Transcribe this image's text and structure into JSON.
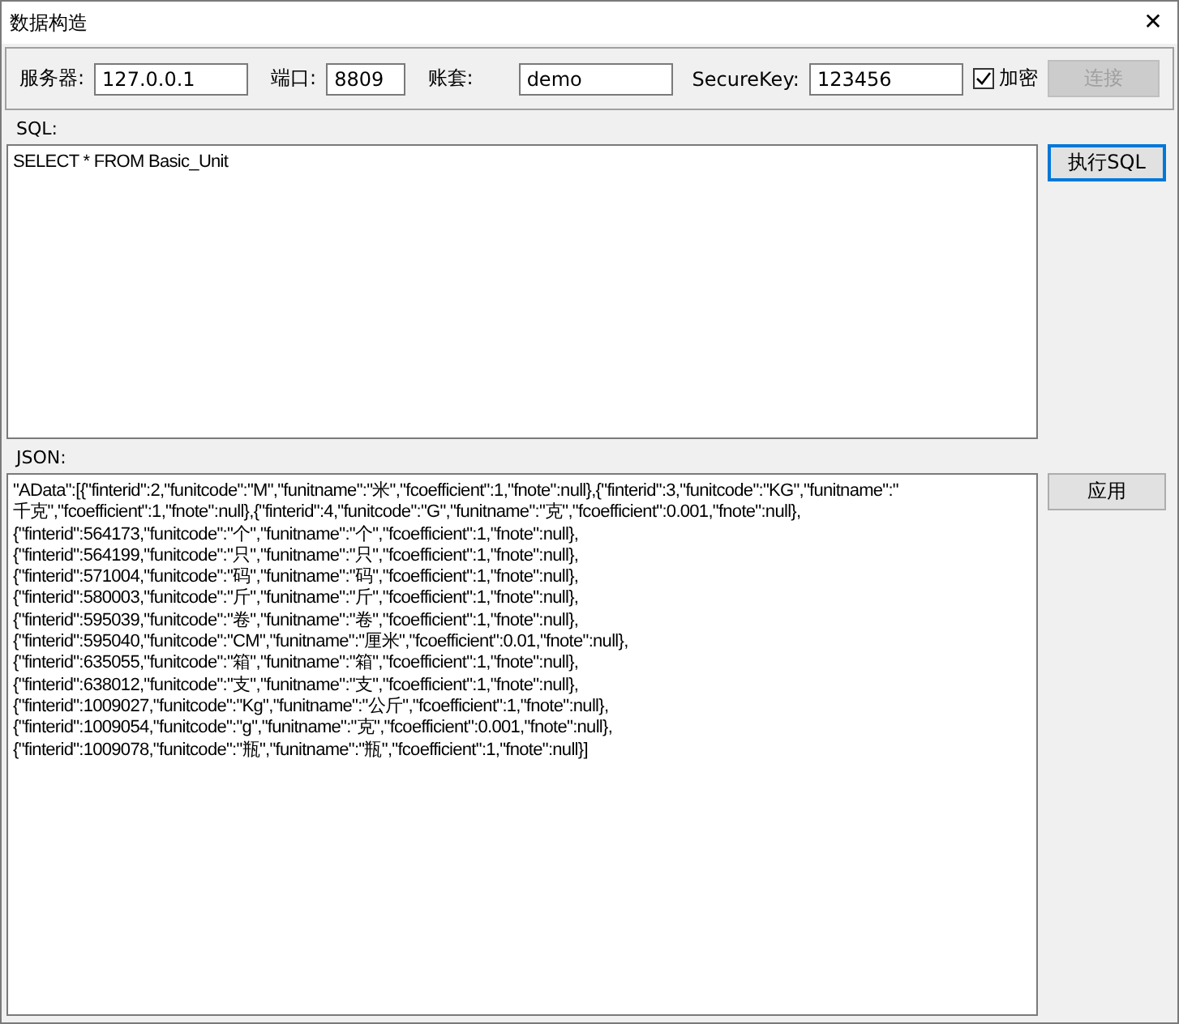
{
  "window": {
    "title": "数据构造",
    "close": "✕"
  },
  "connection": {
    "fields": [
      {
        "label": "服务器:",
        "value": "127.0.0.1",
        "kind": "wide"
      },
      {
        "label": "端口:",
        "value": "8809",
        "kind": "narrow"
      },
      {
        "label": "账套:",
        "value": "demo",
        "kind": "wide"
      },
      {
        "label": "SecureKey:",
        "value": "123456",
        "kind": "wide"
      }
    ],
    "encrypt": {
      "label": "加密",
      "checked": true
    },
    "connect_button": {
      "label": "连接",
      "disabled": true
    }
  },
  "sql": {
    "label": "SQL:",
    "value": "SELECT * FROM Basic_Unit",
    "button": "执行SQL"
  },
  "json": {
    "label": "JSON:",
    "button": "应用",
    "lines": [
      "\"AData\":[{\"finterid\":2,\"funitcode\":\"M\",\"funitname\":\"米\",\"fcoefficient\":1,\"fnote\":null},{\"finterid\":3,\"funitcode\":\"KG\",\"funitname\":\"",
      "千克\",\"fcoefficient\":1,\"fnote\":null},{\"finterid\":4,\"funitcode\":\"G\",\"funitname\":\"克\",\"fcoefficient\":0.001,\"fnote\":null},",
      "{\"finterid\":564173,\"funitcode\":\"个\",\"funitname\":\"个\",\"fcoefficient\":1,\"fnote\":null},",
      "{\"finterid\":564199,\"funitcode\":\"只\",\"funitname\":\"只\",\"fcoefficient\":1,\"fnote\":null},",
      "{\"finterid\":571004,\"funitcode\":\"码\",\"funitname\":\"码\",\"fcoefficient\":1,\"fnote\":null},",
      "{\"finterid\":580003,\"funitcode\":\"斤\",\"funitname\":\"斤\",\"fcoefficient\":1,\"fnote\":null},",
      "{\"finterid\":595039,\"funitcode\":\"卷\",\"funitname\":\"卷\",\"fcoefficient\":1,\"fnote\":null},",
      "{\"finterid\":595040,\"funitcode\":\"CM\",\"funitname\":\"厘米\",\"fcoefficient\":0.01,\"fnote\":null},",
      "{\"finterid\":635055,\"funitcode\":\"箱\",\"funitname\":\"箱\",\"fcoefficient\":1,\"fnote\":null},",
      "{\"finterid\":638012,\"funitcode\":\"支\",\"funitname\":\"支\",\"fcoefficient\":1,\"fnote\":null},",
      "{\"finterid\":1009027,\"funitcode\":\"Kg\",\"funitname\":\"公斤\",\"fcoefficient\":1,\"fnote\":null},",
      "{\"finterid\":1009054,\"funitcode\":\"g\",\"funitname\":\"克\",\"fcoefficient\":0.001,\"fnote\":null},",
      "{\"finterid\":1009078,\"funitcode\":\"瓶\",\"funitname\":\"瓶\",\"fcoefficient\":1,\"fnote\":null}]"
    ]
  }
}
